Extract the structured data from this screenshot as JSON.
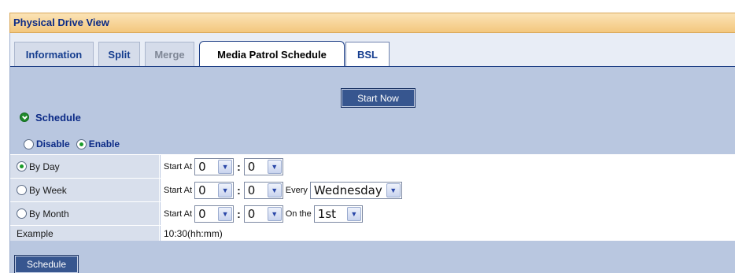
{
  "panel": {
    "title": "Physical Drive View"
  },
  "tabs": [
    {
      "label": "Information",
      "state": "normal"
    },
    {
      "label": "Split",
      "state": "normal"
    },
    {
      "label": "Merge",
      "state": "disabled"
    },
    {
      "label": "Media Patrol Schedule",
      "state": "active"
    },
    {
      "label": "BSL",
      "state": "normal"
    }
  ],
  "actions": {
    "start_now": "Start Now",
    "schedule": "Schedule"
  },
  "schedule": {
    "heading": "Schedule",
    "disable_label": "Disable",
    "enable_label": "Enable",
    "enabled": true,
    "start_at_label": "Start At",
    "every_label": "Every",
    "on_the_label": "On the",
    "colon": ":",
    "by_day": {
      "label": "By Day",
      "selected": true,
      "hour": "0",
      "minute": "0"
    },
    "by_week": {
      "label": "By Week",
      "selected": false,
      "hour": "0",
      "minute": "0",
      "weekday": "Wednesday"
    },
    "by_month": {
      "label": "By Month",
      "selected": false,
      "hour": "0",
      "minute": "0",
      "day": "1st"
    },
    "example": {
      "label": "Example",
      "value": "10:30(hh:mm)"
    }
  },
  "colors": {
    "title_bar": "#f3c77e",
    "title_text": "#0b2a86",
    "content_bg": "#b9c7e0",
    "button_bg": "#37568f",
    "active_radio": "#1b9b2a"
  },
  "icons": {
    "schedule_heading": "green-check-circle-icon",
    "dropdown": "chevron-down-icon"
  }
}
